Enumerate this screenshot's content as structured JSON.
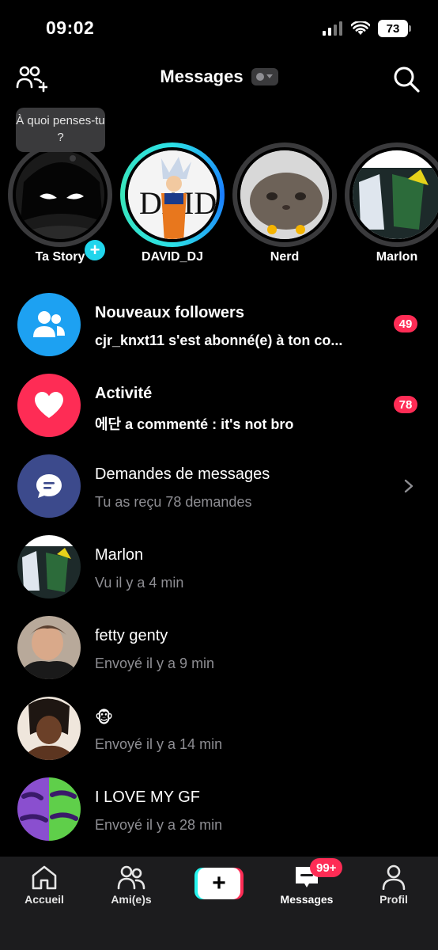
{
  "status_bar": {
    "time": "09:02",
    "battery": "73"
  },
  "header": {
    "title": "Messages"
  },
  "stories": {
    "tooltip": "À quoi penses-tu ?",
    "items": [
      {
        "label": "Ta Story"
      },
      {
        "label": "DAVID_DJ"
      },
      {
        "label": "Nerd"
      },
      {
        "label": "Marlon"
      }
    ]
  },
  "list": [
    {
      "title": "Nouveaux followers",
      "sub": "cjr_knxt11 s'est abonné(e) à ton co...",
      "badge": "49",
      "icon": "followers-icon",
      "color": "#1da1f2"
    },
    {
      "title": "Activité",
      "sub": "에단 a commenté : it's not bro",
      "badge": "78",
      "icon": "heart-icon",
      "color": "#fe2c55"
    },
    {
      "title": "Demandes de messages",
      "sub": "Tu as reçu 78 demandes",
      "icon": "chat-bubble-icon",
      "color": "#3c4a8c"
    },
    {
      "title": "Marlon",
      "sub": "Vu il y a 4 min"
    },
    {
      "title": "fetty genty",
      "sub": "Envoyé il y a 9 min"
    },
    {
      "title": "🐵",
      "sub": "Envoyé il y a 14 min"
    },
    {
      "title": "I LOVE MY GF",
      "sub": "Envoyé il y a 28 min"
    }
  ],
  "tabbar": {
    "home": "Accueil",
    "friends": "Ami(e)s",
    "messages": "Messages",
    "messages_badge": "99+",
    "profile": "Profil"
  },
  "colors": {
    "accent_red": "#fe2c55",
    "accent_cyan": "#25f4ee",
    "background": "#000000"
  }
}
